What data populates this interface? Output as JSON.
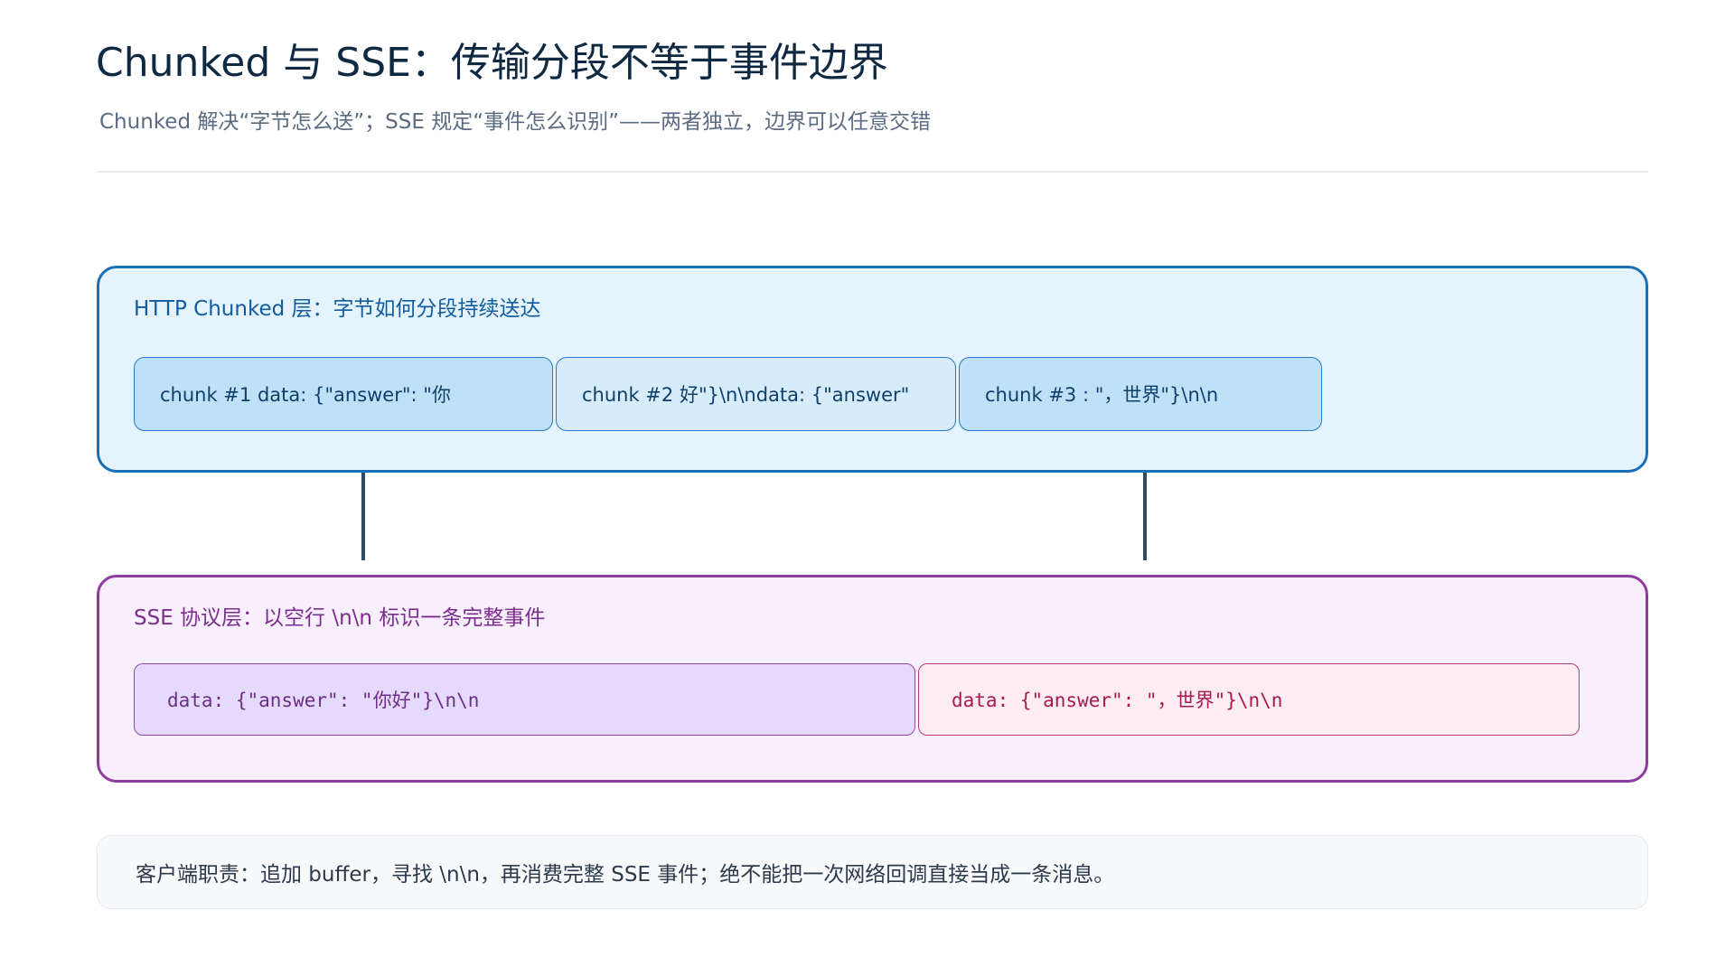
{
  "header": {
    "title": "Chunked 与 SSE：传输分段不等于事件边界",
    "subtitle": "Chunked 解决“字节怎么送”；SSE 规定“事件怎么识别”——两者独立，边界可以任意交错"
  },
  "http_layer": {
    "label": "HTTP Chunked 层：字节如何分段持续送达",
    "chunks": [
      {
        "text": "chunk #1  data: {\"answer\": \"你"
      },
      {
        "text": "chunk #2  好\"}\\n\\ndata: {\"answer\""
      },
      {
        "text": "chunk #3  : \"，世界\"}\\n\\n"
      }
    ]
  },
  "sse_layer": {
    "label": "SSE 协议层：以空行 \\n\\n 标识一条完整事件",
    "events": [
      {
        "text": "data: {\"answer\": \"你好\"}\\n\\n"
      },
      {
        "text": "data: {\"answer\": \"，世界\"}\\n\\n"
      }
    ]
  },
  "note": {
    "text": "客户端职责：追加 buffer，寻找 \\n\\n，再消费完整 SSE 事件；绝不能把一次网络回调直接当成一条消息。"
  },
  "colors": {
    "http_border": "#1a70b8",
    "http_fill": "#e5f3fd",
    "sse_border": "#8e3b9f",
    "sse_fill": "#f8effc",
    "event1_fill": "#e6dafc",
    "event2_fill": "#fdedf3",
    "connector": "#2f4b64"
  }
}
